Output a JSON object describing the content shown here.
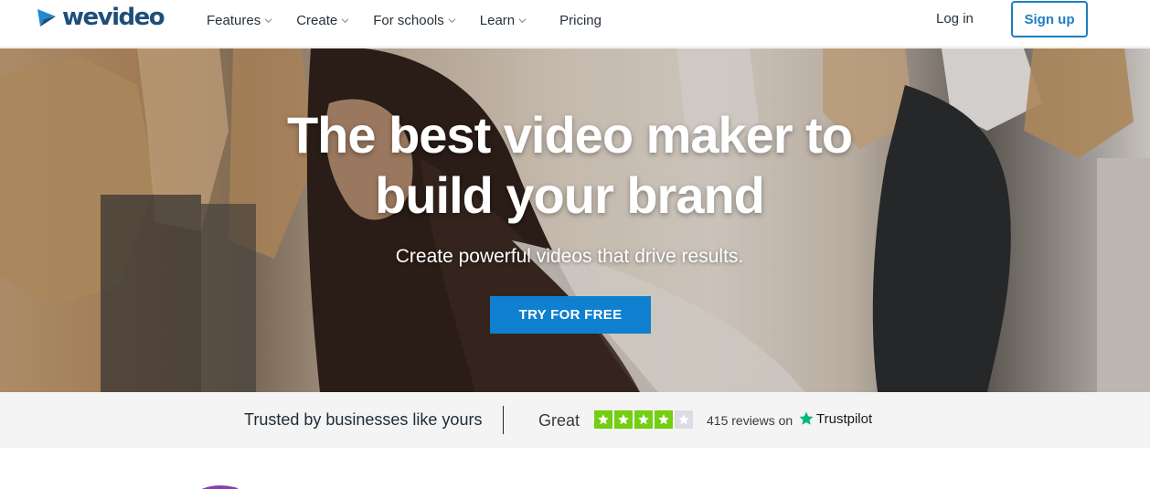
{
  "header": {
    "logo_text_a": "we",
    "logo_text_b": "video",
    "nav": [
      {
        "label": "Features",
        "has_dropdown": true
      },
      {
        "label": "Create",
        "has_dropdown": true
      },
      {
        "label": "For schools",
        "has_dropdown": true
      },
      {
        "label": "Learn",
        "has_dropdown": true
      },
      {
        "label": "Pricing",
        "has_dropdown": false
      }
    ],
    "login_label": "Log in",
    "signup_label": "Sign up"
  },
  "hero": {
    "title_line1": "The best video maker to",
    "title_line2": "build your brand",
    "subtitle": "Create powerful videos that drive results.",
    "cta_label": "TRY FOR FREE"
  },
  "trust": {
    "trusted_label": "Trusted by businesses like yours",
    "rating_word": "Great",
    "stars_filled": 4,
    "stars_total": 5,
    "reviews_text": "415 reviews on",
    "trustpilot_label": "Trustpilot"
  },
  "colors": {
    "brand_blue": "#1e7fc0",
    "cta_blue": "#0f7fcf",
    "trustpilot_green": "#73cf11",
    "trustpilot_star": "#00b67a",
    "accent_purple": "#8a3fb0"
  },
  "icons": [
    "wevideo-logo-icon",
    "chevron-down-icon",
    "star-icon",
    "trustpilot-star-icon"
  ]
}
